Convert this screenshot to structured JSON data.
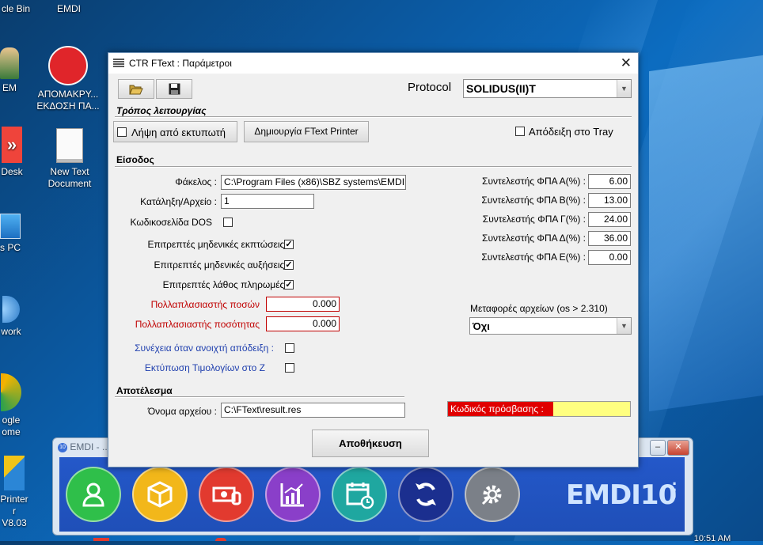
{
  "desktop": {
    "icons": [
      {
        "label": "cle Bin"
      },
      {
        "label": "EMDI"
      },
      {
        "label": "EM"
      },
      {
        "label": "ΑΠΟΜΑΚΡΥ...\nΕΚΔΟΣΗ ΠΑ..."
      },
      {
        "label": "Desk"
      },
      {
        "label": "New Text\nDocument"
      },
      {
        "label": "s PC"
      },
      {
        "label": "work"
      },
      {
        "label": "ogle\nome"
      },
      {
        "label": "Printer\nr V8.03"
      }
    ],
    "clock": "10:51 AM"
  },
  "emdi_window": {
    "title": "EMDI - ...",
    "logo": "EMDI10",
    "minimize": "–",
    "close": "✕",
    "buttons": [
      {
        "icon": "users-icon",
        "color": "#2fbf4a"
      },
      {
        "icon": "box-icon",
        "color": "#f2b71a"
      },
      {
        "icon": "money-icon",
        "color": "#e23a2f"
      },
      {
        "icon": "chart-icon",
        "color": "#8a3fc9"
      },
      {
        "icon": "calendar-icon",
        "color": "#1fa7a0"
      },
      {
        "icon": "sync-icon",
        "color": "#1b2f8f"
      },
      {
        "icon": "settings-icon",
        "color": "#7b8088"
      }
    ]
  },
  "dialog": {
    "title": "CTR FText : Παράμετροι",
    "close": "✕",
    "protocol_label": "Protocol",
    "protocol_value": "SOLIDUS(II)T",
    "section_mode": "Τρόπος λειτουργίας",
    "read_from_printer": "Λήψη από εκτυπωτή",
    "create_printer_button": "Δημιουργία FText Printer",
    "receipt_in_tray": "Απόδειξη στο Tray",
    "section_input": "Είσοδος",
    "folder_label": "Φάκελος :",
    "folder_value": "C:\\Program Files (x86)\\SBZ systems\\EMDI",
    "ext_label": "Κατάληξη/Αρχείο :",
    "ext_value": "1",
    "dos_codepage_label": "Κωδικοσελίδα DOS",
    "zero_discounts_label": "Επιτρεπτές μηδενικές εκπτώσεις :",
    "zero_increases_label": "Επιτρεπτές μηδενικές αυξήσεις :",
    "wrong_payments_label": "Επιτρεπτές λάθος πληρωμές :",
    "amount_multiplier_label": "Πολλαπλασιαστής ποσών",
    "amount_multiplier_value": "0.000",
    "qty_multiplier_label": "Πολλαπλασιαστής ποσότητας",
    "qty_multiplier_value": "0.000",
    "continue_open_receipt_label": "Συνέχεια όταν ανοιχτή απόδειξη :",
    "print_invoices_z_label": "Εκτύπωση Τιμολογίων στο Ζ",
    "vat": [
      {
        "label": "Συντελεστής ΦΠΑ Α(%) :",
        "value": "6.00"
      },
      {
        "label": "Συντελεστής ΦΠΑ Β(%) :",
        "value": "13.00"
      },
      {
        "label": "Συντελεστής ΦΠΑ Γ(%) :",
        "value": "24.00"
      },
      {
        "label": "Συντελεστής ΦΠΑ Δ(%) :",
        "value": "36.00"
      },
      {
        "label": "Συντελεστής ΦΠΑ Ε(%) :",
        "value": "0.00"
      }
    ],
    "file_transfer_label": "Μεταφορές αρχείων (os > 2.310)",
    "file_transfer_value": "Όχι",
    "section_result": "Αποτέλεσμα",
    "filename_label": "Όνομα αρχείου :",
    "filename_value": "C:\\FText\\result.res",
    "access_code_label": "Κωδικός πρόσβασης :",
    "access_code_value": "",
    "save_button": "Αποθήκευση",
    "checks": {
      "read_from_printer": false,
      "receipt_in_tray": false,
      "dos_codepage": false,
      "zero_discounts": true,
      "zero_increases": true,
      "wrong_payments": true,
      "continue_open_receipt": false,
      "print_invoices_z": false
    }
  }
}
